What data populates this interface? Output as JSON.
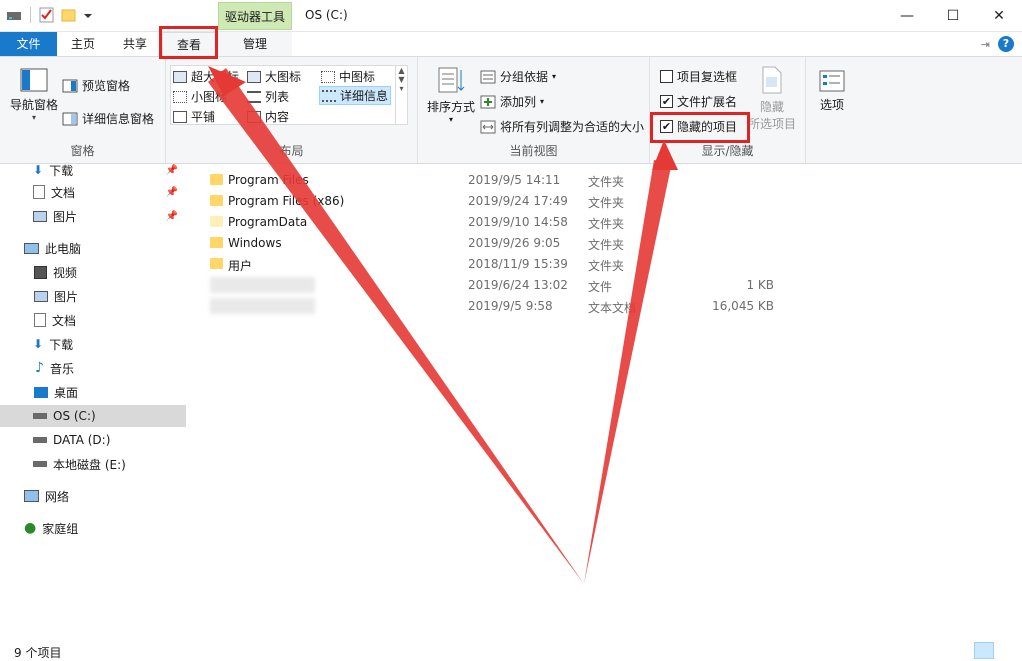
{
  "window": {
    "title": "OS (C:)",
    "context_tab_header": "驱动器工具",
    "controls": {
      "minimize": "—",
      "maximize": "☐",
      "close": "✕"
    }
  },
  "tabs": {
    "file": "文件",
    "home": "主页",
    "share": "共享",
    "view": "查看",
    "manage": "管理"
  },
  "ribbon": {
    "pane": {
      "nav_pane": "导航窗格",
      "preview_pane": "预览窗格",
      "details_pane": "详细信息窗格",
      "group": "窗格"
    },
    "layout": {
      "extra_large": "超大图标",
      "large": "大图标",
      "medium": "中图标",
      "small": "小图标",
      "list": "列表",
      "details": "详细信息",
      "tiles": "平铺",
      "content": "内容",
      "group": "布局"
    },
    "current_view": {
      "sort_by": "排序方式",
      "group_by": "分组依据",
      "add_columns": "添加列",
      "size_all_columns": "将所有列调整为合适的大小",
      "group": "当前视图"
    },
    "show_hide": {
      "item_checkboxes": "项目复选框",
      "file_extensions": "文件扩展名",
      "hidden_items": "隐藏的项目",
      "hide_selected": "隐藏",
      "hide_selected_2": "所选项目",
      "group": "显示/隐藏",
      "item_checkboxes_checked": false,
      "file_extensions_checked": true,
      "hidden_items_checked": true
    },
    "options": "选项"
  },
  "nav": {
    "quick_downloads": "下载",
    "quick_documents": "文档",
    "quick_pictures": "图片",
    "this_pc": "此电脑",
    "videos": "视频",
    "pictures": "图片",
    "documents": "文档",
    "downloads": "下载",
    "music": "音乐",
    "desktop": "桌面",
    "drive_c": "OS (C:)",
    "drive_d": "DATA (D:)",
    "drive_e": "本地磁盘 (E:)",
    "network": "网络",
    "homegroup": "家庭组"
  },
  "files": [
    {
      "name": "Program Files",
      "date": "2019/9/5 14:11",
      "type": "文件夹",
      "size": ""
    },
    {
      "name": "Program Files (x86)",
      "date": "2019/9/24 17:49",
      "type": "文件夹",
      "size": ""
    },
    {
      "name": "ProgramData",
      "date": "2019/9/10 14:58",
      "type": "文件夹",
      "size": ""
    },
    {
      "name": "Windows",
      "date": "2019/9/26 9:05",
      "type": "文件夹",
      "size": ""
    },
    {
      "name": "用户",
      "date": "2018/11/9 15:39",
      "type": "文件夹",
      "size": ""
    },
    {
      "name": "",
      "date": "2019/6/24 13:02",
      "type": "文件",
      "size": "1 KB"
    },
    {
      "name": "",
      "date": "2019/9/5 9:58",
      "type": "文本文档",
      "size": "16,045 KB"
    }
  ],
  "status": {
    "item_count": "9 个项目"
  },
  "colors": {
    "accent": "#1979ca",
    "annotation": "#e02424",
    "context_tab": "#cfe9b4",
    "folder": "#ffd769"
  }
}
